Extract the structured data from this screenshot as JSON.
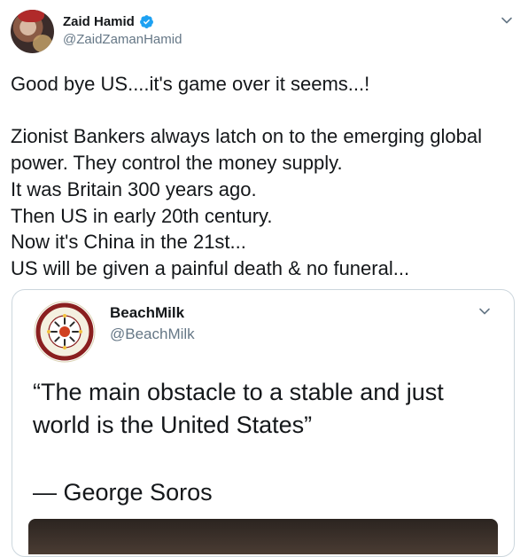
{
  "tweet": {
    "author": {
      "display_name": "Zaid Hamid",
      "handle": "@ZaidZamanHamid",
      "verified": true
    },
    "text": "Good bye US....it's game over it seems...!\n\nZionist Bankers always latch on to the emerging global power. They control the money supply.\nIt was Britain 300 years ago.\nThen US in early 20th century.\nNow it's China in the 21st...\nUS will be given a painful death & no funeral...",
    "menu_icon": "chevron-down-icon"
  },
  "quoted_tweet": {
    "author": {
      "display_name": "BeachMilk",
      "handle": "@BeachMilk"
    },
    "quote": "“The main obstacle to a stable and just world is the United States”",
    "attribution": "— George Soros",
    "menu_icon": "chevron-down-icon"
  },
  "colors": {
    "text": "#14171a",
    "secondary": "#657786",
    "verified": "#1da1f2",
    "border": "#ccd6dd"
  }
}
